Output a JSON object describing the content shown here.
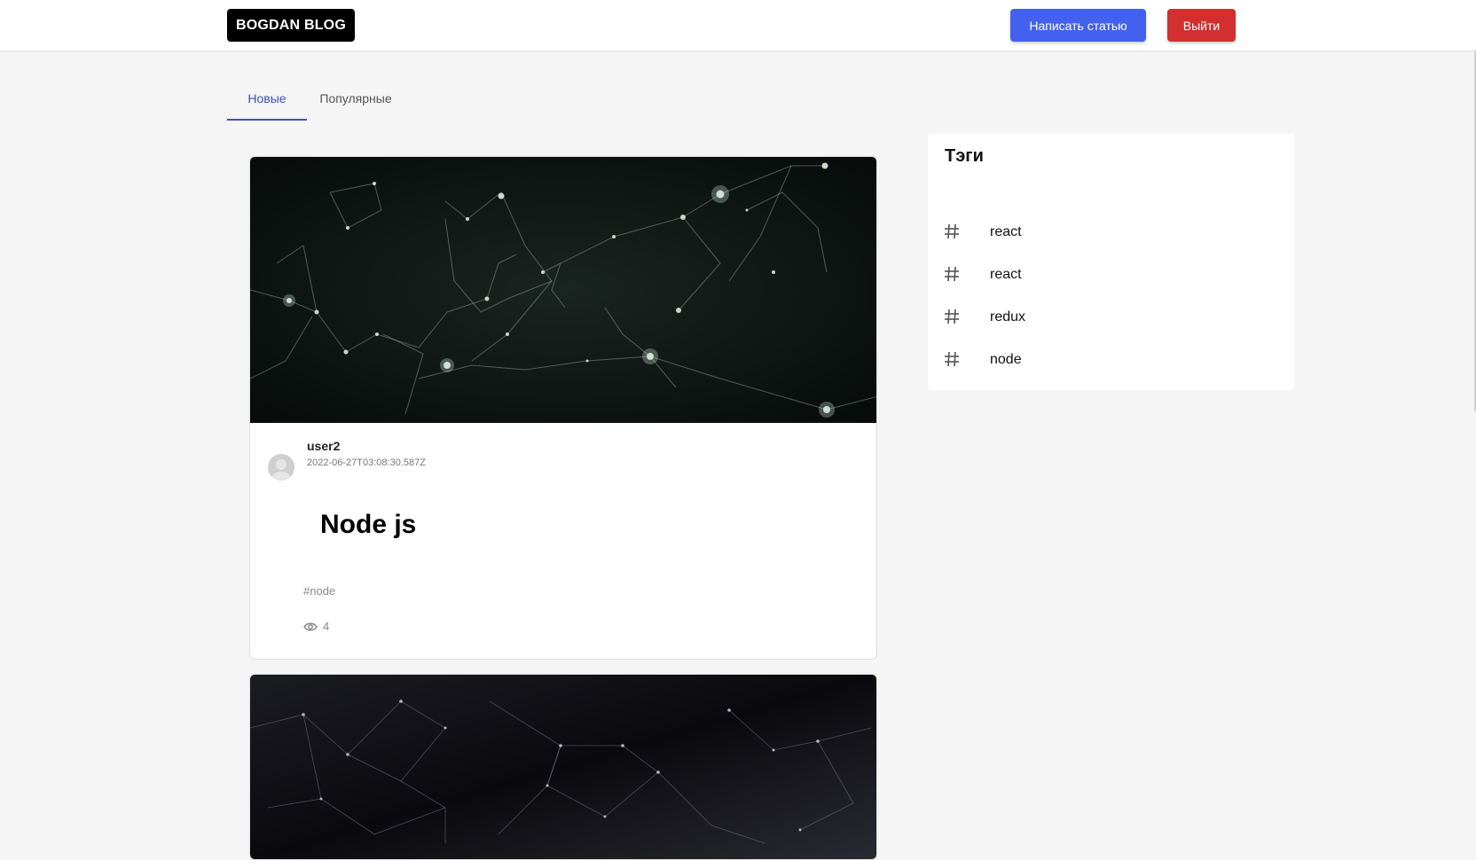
{
  "header": {
    "logo": "BOGDAN BLOG",
    "write_button": "Написать статью",
    "logout_button": "Выйти"
  },
  "tabs": [
    {
      "label": "Новые",
      "active": true
    },
    {
      "label": "Популярные",
      "active": false
    }
  ],
  "posts": [
    {
      "author": "user2",
      "date": "2022-06-27T03:08:30.587Z",
      "title": "Node js",
      "tags": "#node",
      "views": "4"
    }
  ],
  "tags_panel": {
    "title": "Тэги",
    "items": [
      "react",
      "react",
      "redux",
      "node"
    ]
  },
  "colors": {
    "accent": "#4361ee",
    "danger": "#d32f2f",
    "tab_active": "#3f51b5"
  }
}
